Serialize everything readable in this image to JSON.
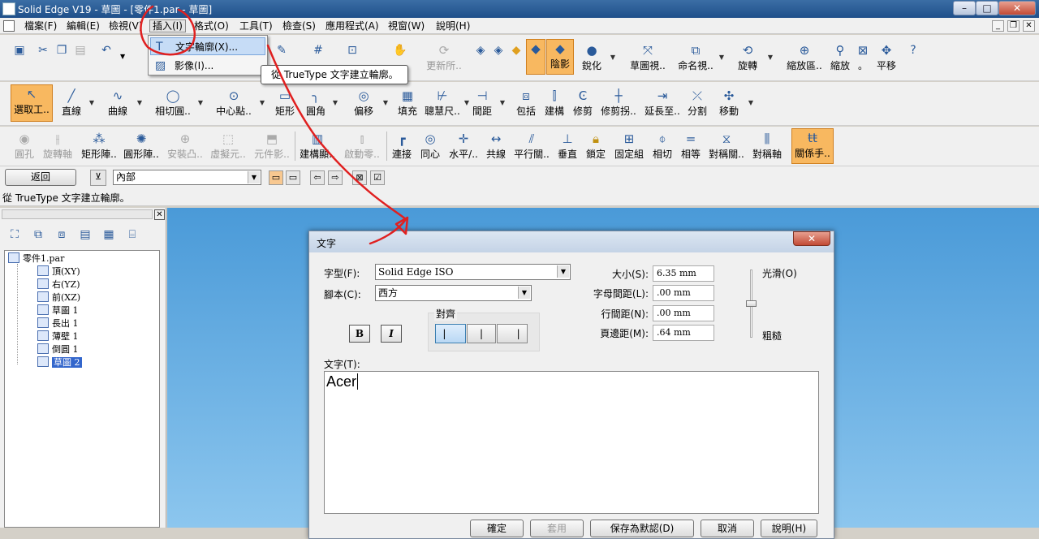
{
  "window": {
    "title": "Solid Edge V19 - 草圖 - [零件1.par - 草圖]",
    "min": "–",
    "max": "□",
    "close": "✕",
    "mdi_min": "_",
    "mdi_restore": "❐",
    "mdi_close": "✕"
  },
  "menu": [
    "檔案(F)",
    "編輯(E)",
    "檢視(V)",
    "插入(I)",
    "格式(O)",
    "工具(T)",
    "檢查(S)",
    "應用程式(A)",
    "視窗(W)",
    "說明(H)"
  ],
  "toolbar1": {
    "shade": "陰影",
    "sharpen": "銳化",
    "sketch_view": "草圖視..",
    "named_view": "命名視..",
    "rotate": "旋轉",
    "zoom_area": "縮放區..",
    "zoom": "縮放",
    "dot": "。",
    "pan": "平移",
    "update": "更新所..",
    "help": "?"
  },
  "toolbar2": [
    "選取工..",
    "直線",
    "曲線",
    "相切圓..",
    "中心點..",
    "矩形",
    "圓角",
    "偏移",
    "填充",
    "聰慧尺..",
    "間距",
    "包括",
    "建構",
    "修剪",
    "修剪拐..",
    "延長至..",
    "分割",
    "移動"
  ],
  "toolbar3": [
    "圓孔",
    "旋轉軸",
    "矩形陣..",
    "圓形陣..",
    "安裝凸..",
    "虛擬元..",
    "元件影..",
    "建構顯..",
    "啟動零..",
    "連接",
    "同心",
    "水平/..",
    "共線",
    "平行關..",
    "垂直",
    "鎖定",
    "固定組",
    "相切",
    "相等",
    "對稱關..",
    "對稱軸",
    "關係手.."
  ],
  "cmdbar": {
    "return": "返回",
    "plane": "內部"
  },
  "prompt": "從 TrueType 文字建立輪廓。",
  "tree": {
    "root": "零件1.par",
    "items": [
      "頂(XY)",
      "右(YZ)",
      "前(XZ)",
      "草圖 1",
      "長出 1",
      "薄壁 1",
      "倒圓 1",
      "草圖 2"
    ]
  },
  "insert_menu": {
    "items": [
      "文字輪廓(X)...",
      "影像(I)..."
    ],
    "tooltip": "從 TrueType 文字建立輪廓。"
  },
  "dialog": {
    "title": "文字",
    "close": "✕",
    "font_label": "字型(F):",
    "font_value": "Solid Edge ISO",
    "script_label": "腳本(C):",
    "script_value": "西方",
    "align_label": "對齊",
    "bold": "B",
    "italic": "I",
    "size_label": "大小(S):",
    "size_value": "6.35 mm",
    "char_spacing_label": "字母間距(L):",
    "char_spacing_value": ".00 mm",
    "line_spacing_label": "行間距(N):",
    "line_spacing_value": ".00 mm",
    "margin_label": "頁邊距(M):",
    "margin_value": ".64 mm",
    "smooth": "光滑(O)",
    "coarse": "粗糙",
    "text_label": "文字(T):",
    "text_value": "Acer",
    "buttons": [
      "確定",
      "套用",
      "保存為默認(D)",
      "取消",
      "說明(H)"
    ]
  },
  "colors": {
    "accent": "#f8b860",
    "selection": "#3366cc",
    "canvas_top": "#4a9ad8",
    "canvas_bottom": "#8cc6ee",
    "annotation": "#e02020"
  }
}
